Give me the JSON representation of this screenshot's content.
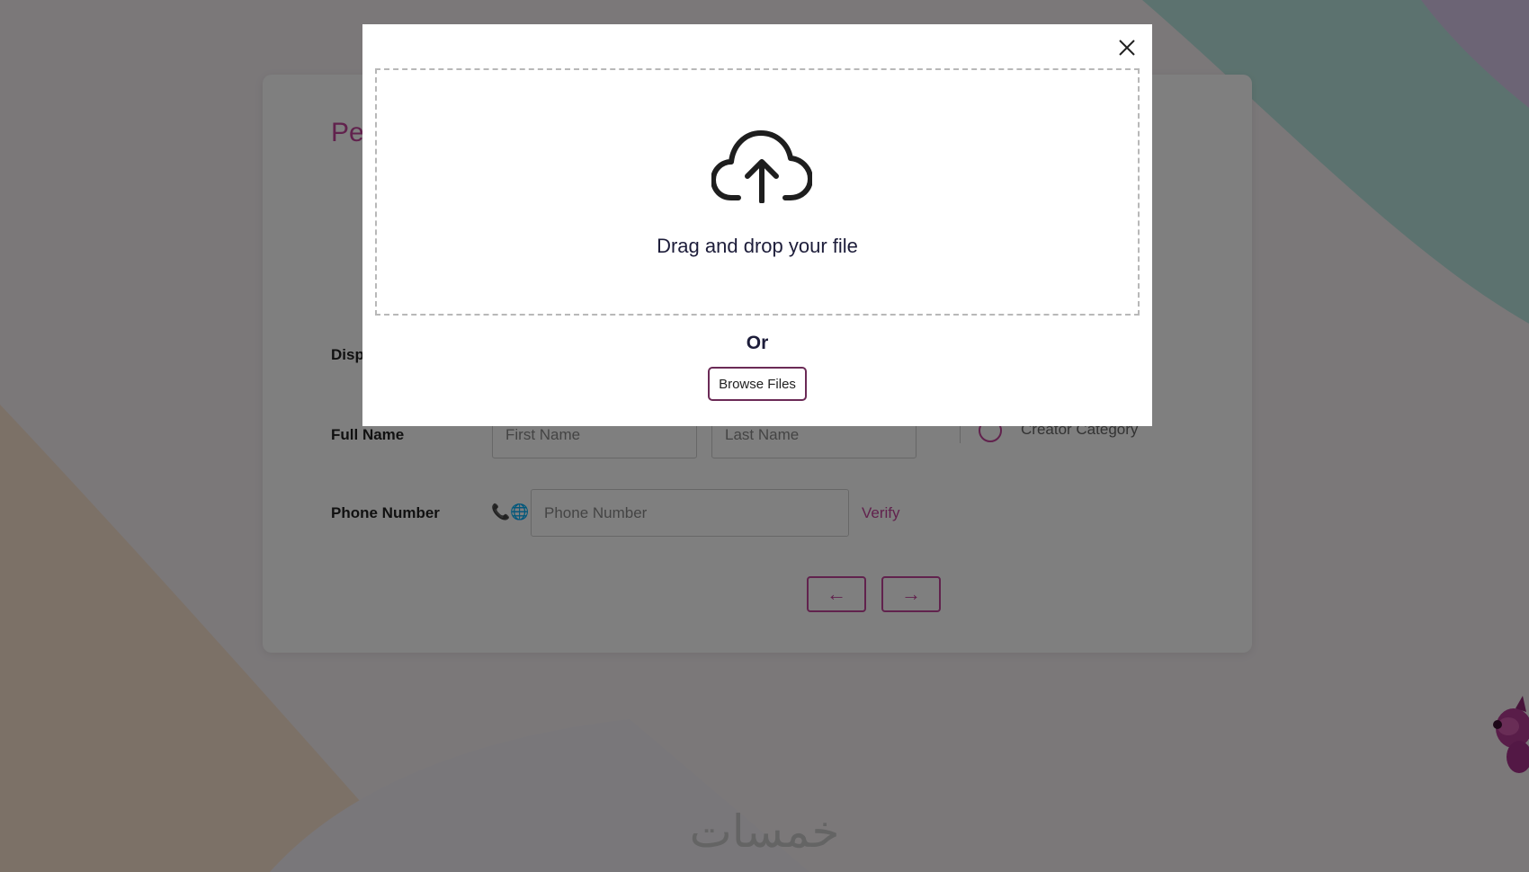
{
  "page": {
    "accent_color": "#c2449b",
    "overlay_color": "rgba(0,0,0,0.5)"
  },
  "form": {
    "title_partial": "Pe",
    "display_label_partial": "Disp",
    "full_name_label": "Full Name",
    "first_name_placeholder": "First Name",
    "last_name_placeholder": "Last Name",
    "creator_category_label": "Creator Category",
    "phone_label": "Phone Number",
    "phone_placeholder": "Phone Number",
    "phone_country_icon": "phone-globe-icon",
    "phone_country_glyph": "📞🌐⌄",
    "verify_label": "Verify",
    "back_arrow": "←",
    "next_arrow": "→"
  },
  "upload_modal": {
    "close_icon": "close-icon",
    "upload_icon": "cloud-upload-icon",
    "drop_text": "Drag and drop your file",
    "or_text": "Or",
    "browse_label": "Browse Files"
  },
  "footer": {
    "logo_text": "خمسات"
  }
}
